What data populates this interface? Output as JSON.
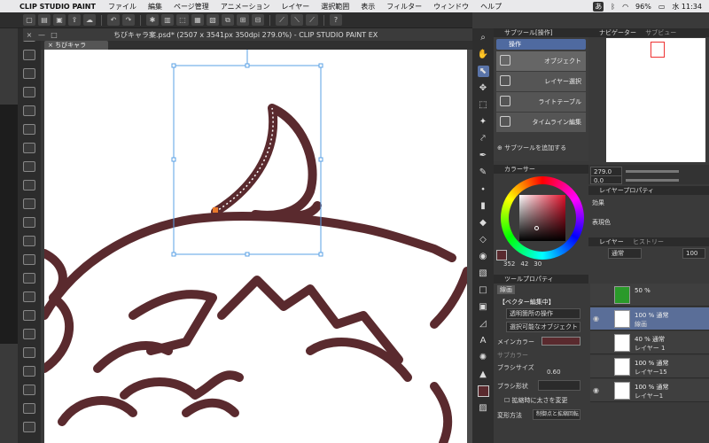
{
  "menubar": {
    "apple": "",
    "app_name": "CLIP STUDIO PAINT",
    "items": [
      "ファイル",
      "編集",
      "ページ管理",
      "アニメーション",
      "レイヤー",
      "選択範囲",
      "表示",
      "フィルター",
      "ウィンドウ",
      "ヘルプ"
    ],
    "battery": "96%",
    "ime": "あ",
    "clock": "水 11:34"
  },
  "window": {
    "title": "ちびキャラ案.psd* (2507 x 3541px 350dpi 279.0%)  - CLIP STUDIO PAINT EX",
    "tab_label": "ちびキャラ案.psd*"
  },
  "subtool": {
    "header": "サブツール[操作]",
    "group": "操作",
    "items": [
      "オブジェクト",
      "レイヤー選択",
      "ライトテーブル",
      "タイムライン編集"
    ],
    "add_label": "サブツールを追加する"
  },
  "color": {
    "header": "カラーサー",
    "hue": "352",
    "sat": "42",
    "val": "30",
    "main_color": "#5a2a2e"
  },
  "tool_property": {
    "header": "ツールプロパティ",
    "mode_tab": "線画",
    "mode_label": "【ベクター編集中】",
    "transparent_op": "透明箇所の操作",
    "selectable_obj": "選択可能なオブジェクト",
    "main_color_label": "メインカラー",
    "sub_color_label": "サブカラー",
    "brush_size_label": "ブラシサイズ",
    "brush_size_value": "0.60",
    "brush_shape_label": "ブラシ形状",
    "scale_checkbox_label": "拡縮時に太さを変更",
    "transform_label": "変形方法",
    "transform_value": "制御点と拡縮回転"
  },
  "navigator": {
    "header": "ナビゲーター",
    "secondary_tab": "サブビュー",
    "zoom": "279.0",
    "rotation": "0.0"
  },
  "layer_property": {
    "header": "レイヤープロパティ",
    "effect_label": "効果",
    "expression_label": "表現色"
  },
  "layers": {
    "header": "レイヤー",
    "secondary_tab": "ヒストリー",
    "blend_mode": "通常",
    "opacity": "100",
    "items": [
      {
        "line1": "50 %",
        "line2": "",
        "thumb": "#2a9a2a",
        "selected": false
      },
      {
        "line1": "100 % 通常",
        "line2": "線画",
        "thumb": "#ffffff",
        "selected": true
      },
      {
        "line1": "40 % 通常",
        "line2": "レイヤー 1",
        "thumb": "#ffffff",
        "selected": false
      },
      {
        "line1": "100 % 通常",
        "line2": "レイヤー15",
        "thumb": "#ffffff",
        "selected": false
      },
      {
        "line1": "100 % 通常",
        "line2": "レイヤー1",
        "thumb": "#ffffff",
        "selected": false
      }
    ]
  }
}
